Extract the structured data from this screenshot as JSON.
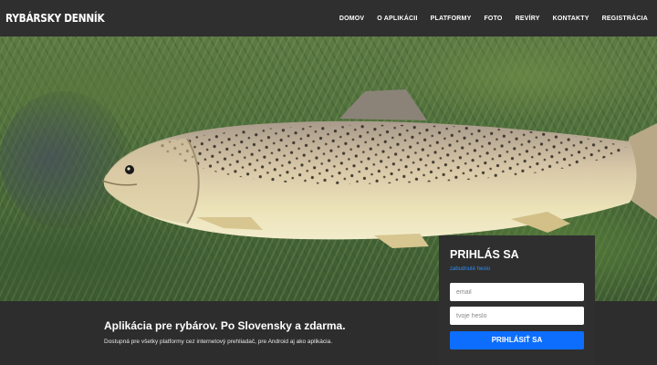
{
  "header": {
    "brand": "RYBÁRSKY DENNÍK",
    "nav": [
      {
        "label": "DOMOV"
      },
      {
        "label": "O APLIKÁCII"
      },
      {
        "label": "PLATFORMY"
      },
      {
        "label": "FOTO"
      },
      {
        "label": "REVÍRY"
      },
      {
        "label": "KONTAKTY"
      },
      {
        "label": "REGISTRÁCIA"
      }
    ]
  },
  "hero": {
    "image": "brown-trout-on-grass-photo"
  },
  "login": {
    "title": "PRIHLÁS SA",
    "forgot_link": "zabudnuté heslo",
    "email_placeholder": "email",
    "password_placeholder": "tvoje heslo",
    "submit_label": "PRIHLÁSIŤ SA"
  },
  "main": {
    "headline": "Aplikácia pre rybárov. Po Slovensky a zdarma.",
    "description": "Dostupná pre všetky platformy cez internetový prehliadač, pre Android aj ako aplikácia."
  },
  "colors": {
    "header_bg": "#2f2f2f",
    "accent": "#0d6efd",
    "link": "#2f8ef2"
  }
}
